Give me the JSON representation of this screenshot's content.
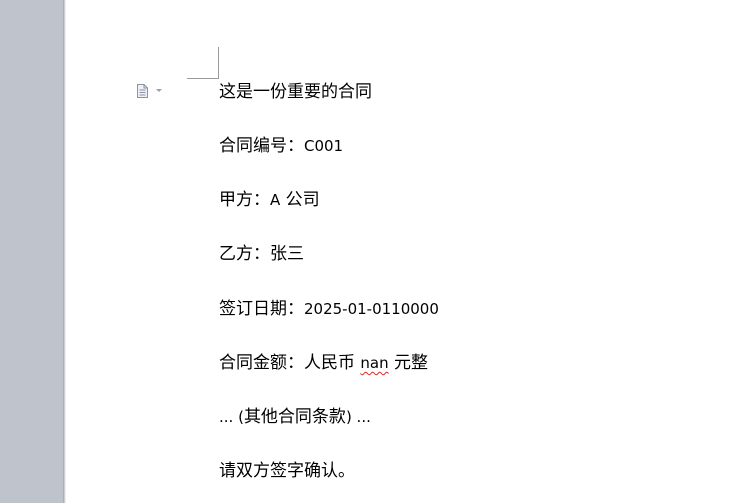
{
  "document": {
    "title": "这是一份重要的合同",
    "contract_no_label": "合同编号：",
    "contract_no": "C001",
    "party_a_label": "甲方：",
    "party_a_letter": "A",
    "party_a_suffix": "公司",
    "party_b_label": "乙方：",
    "party_b": "张三",
    "date_label": "签订日期：",
    "date": "2025-01-0110000",
    "amount_label": "合同金额：人民币",
    "amount": "nan",
    "amount_suffix": "元整",
    "other_prefix": "... (",
    "other_text": "其他合同条款",
    "other_suffix": ") ...",
    "closing": "请双方签字确认。"
  },
  "icons": {
    "paragraph_marker": "document-icon"
  },
  "colors": {
    "workspace": "#bfc3cc",
    "page": "#ffffff",
    "spellcheck_underline": "#e0262a"
  }
}
